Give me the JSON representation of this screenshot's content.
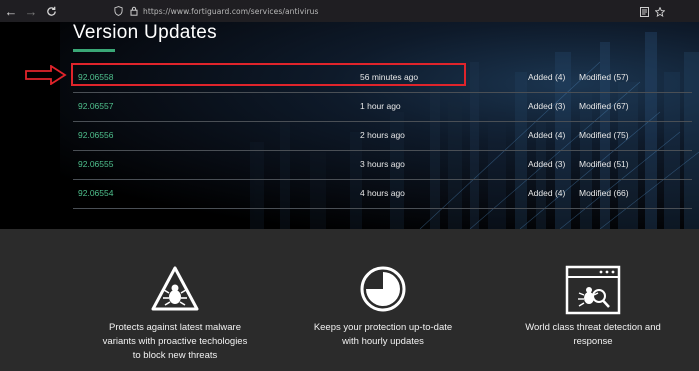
{
  "browser": {
    "url": "https://www.fortiguard.com/services/antivirus",
    "back_icon": "arrow-left-icon",
    "forward_icon": "arrow-right-icon",
    "reload_icon": "reload-icon"
  },
  "section": {
    "title": "Version Updates"
  },
  "updates": [
    {
      "version": "92.06558",
      "time": "56 minutes ago",
      "added": "Added (4)",
      "modified": "Modified (57)"
    },
    {
      "version": "92.06557",
      "time": "1 hour ago",
      "added": "Added (3)",
      "modified": "Modified (67)"
    },
    {
      "version": "92.06556",
      "time": "2 hours ago",
      "added": "Added (4)",
      "modified": "Modified (75)"
    },
    {
      "version": "92.06555",
      "time": "3 hours ago",
      "added": "Added (3)",
      "modified": "Modified (51)"
    },
    {
      "version": "92.06554",
      "time": "4 hours ago",
      "added": "Added (4)",
      "modified": "Modified (66)"
    }
  ],
  "features": [
    {
      "icon": "bug-warning-icon",
      "line1": "Protects against latest malware",
      "line2": "variants with proactive techologies",
      "line3": "to block new threats"
    },
    {
      "icon": "clock-pie-icon",
      "line1": "Keeps your protection up-to-date",
      "line2": "with hourly updates",
      "line3": ""
    },
    {
      "icon": "browser-bug-search-icon",
      "line1": "World class threat detection and",
      "line2": "response",
      "line3": ""
    }
  ],
  "colors": {
    "version_link": "#4fc08d",
    "accent_underline": "#3aa776",
    "annotation_red": "#e0242b"
  }
}
